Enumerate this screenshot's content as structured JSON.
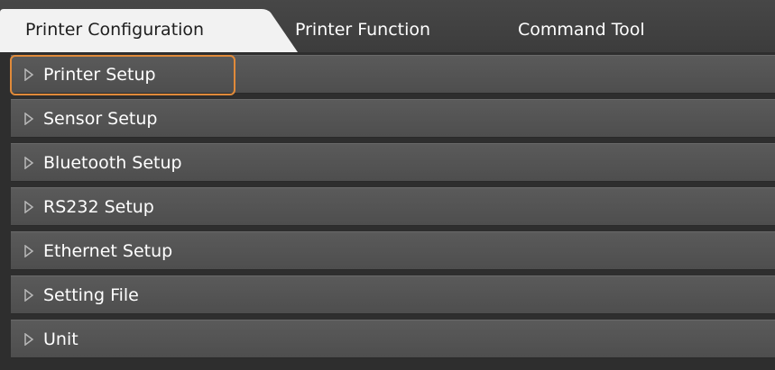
{
  "tabs": [
    {
      "label": "Printer Configuration",
      "active": true
    },
    {
      "label": "Printer Function",
      "active": false
    },
    {
      "label": "Command Tool",
      "active": false
    }
  ],
  "sections": [
    {
      "label": "Printer Setup",
      "focused": true
    },
    {
      "label": "Sensor Setup",
      "focused": false
    },
    {
      "label": "Bluetooth Setup",
      "focused": false
    },
    {
      "label": "RS232 Setup",
      "focused": false
    },
    {
      "label": "Ethernet Setup",
      "focused": false
    },
    {
      "label": "Setting File",
      "focused": false
    },
    {
      "label": "Unit",
      "focused": false
    }
  ],
  "colors": {
    "active_tab": "#f2f2f2",
    "row_bg": "#555555",
    "focus_ring": "#e08a3a",
    "text": "#ffffff"
  },
  "icons": {
    "expander": "chevron-right-icon"
  }
}
